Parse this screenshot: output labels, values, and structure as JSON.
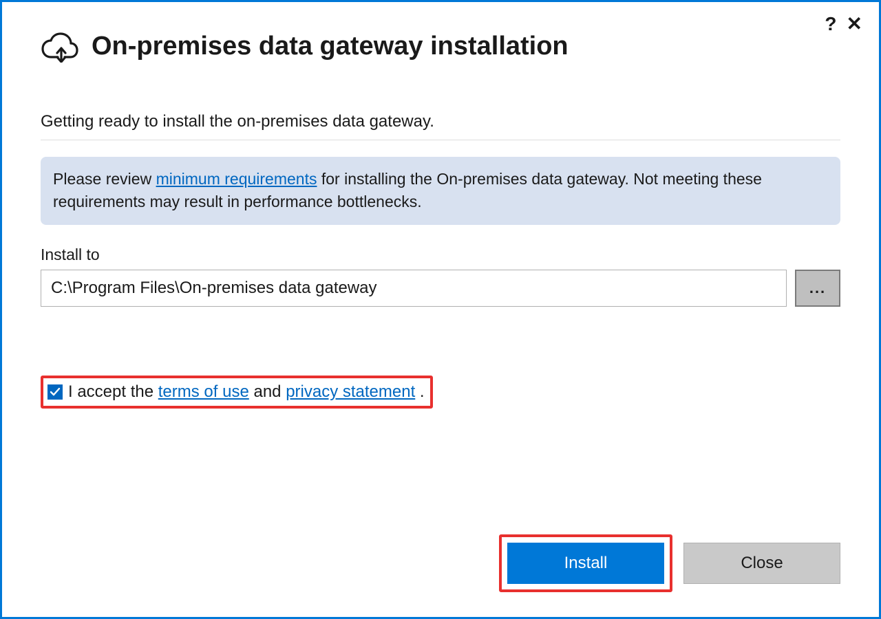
{
  "window": {
    "title": "On-premises data gateway installation"
  },
  "subtitle": "Getting ready to install the on-premises data gateway.",
  "info_banner": {
    "before_link": "Please review ",
    "link_text": "minimum requirements",
    "after_link": " for installing the On-premises data gateway. Not meeting these requirements may result in performance bottlenecks."
  },
  "install_to": {
    "label": "Install to",
    "path": "C:\\Program Files\\On-premises data gateway",
    "browse_label": "..."
  },
  "accept": {
    "checked": true,
    "prefix": "I accept the ",
    "terms_link": "terms of use",
    "middle": " and ",
    "privacy_link": "privacy statement",
    "suffix": " ."
  },
  "buttons": {
    "install": "Install",
    "close": "Close"
  },
  "icons": {
    "help": "?",
    "close": "✕"
  }
}
